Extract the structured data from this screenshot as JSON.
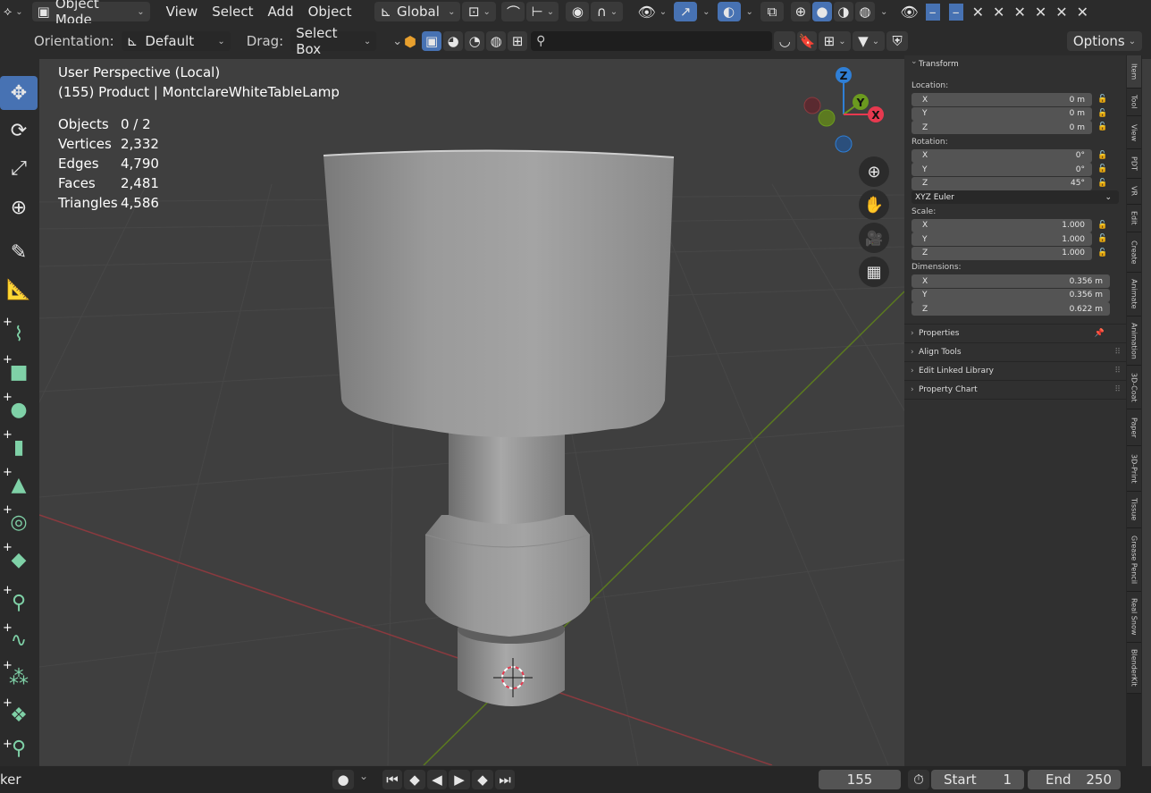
{
  "header": {
    "mode": "Object Mode",
    "menus": [
      "View",
      "Select",
      "Add",
      "Object"
    ],
    "transform_orientation": "Global",
    "options_label": "Options"
  },
  "tool_header": {
    "orientation_label": "Orientation:",
    "orientation_value": "Default",
    "drag_label": "Drag:",
    "drag_value": "Select Box",
    "search_placeholder": ""
  },
  "viewport": {
    "view_name": "User Perspective (Local)",
    "object_info": "(155) Product | MontclareWhiteTableLamp",
    "stats": [
      {
        "label": "Objects",
        "value": "0 / 2"
      },
      {
        "label": "Vertices",
        "value": "2,332"
      },
      {
        "label": "Edges",
        "value": "4,790"
      },
      {
        "label": "Faces",
        "value": "2,481"
      },
      {
        "label": "Triangles",
        "value": "4,586"
      }
    ],
    "gizmo": {
      "z": "Z",
      "y": "Y",
      "x": "X"
    }
  },
  "npanel": {
    "transform_title": "Transform",
    "location_label": "Location:",
    "location": [
      {
        "axis": "X",
        "value": "0 m"
      },
      {
        "axis": "Y",
        "value": "0 m"
      },
      {
        "axis": "Z",
        "value": "0 m"
      }
    ],
    "rotation_label": "Rotation:",
    "rotation": [
      {
        "axis": "X",
        "value": "0°"
      },
      {
        "axis": "Y",
        "value": "0°"
      },
      {
        "axis": "Z",
        "value": "45°"
      }
    ],
    "rotation_mode": "XYZ Euler",
    "scale_label": "Scale:",
    "scale": [
      {
        "axis": "X",
        "value": "1.000"
      },
      {
        "axis": "Y",
        "value": "1.000"
      },
      {
        "axis": "Z",
        "value": "1.000"
      }
    ],
    "dimensions_label": "Dimensions:",
    "dimensions": [
      {
        "axis": "X",
        "value": "0.356 m"
      },
      {
        "axis": "Y",
        "value": "0.356 m"
      },
      {
        "axis": "Z",
        "value": "0.622 m"
      }
    ],
    "sections": [
      "Properties",
      "Align Tools",
      "Edit Linked Library",
      "Property Chart"
    ]
  },
  "side_tabs": [
    "Item",
    "Tool",
    "View",
    "PDT",
    "VR",
    "Edit",
    "Create",
    "Animate",
    "Animation",
    "3D-Coat",
    "Paper",
    "3D-Print",
    "Tissue",
    "Grease Pencil",
    "Real Snow",
    "BlenderKit"
  ],
  "timeline": {
    "left_label": "ker",
    "current_frame": "155",
    "start_label": "Start",
    "start_value": "1",
    "end_label": "End",
    "end_value": "250"
  },
  "colors": {
    "accent": "#4772b3",
    "x_axis": "#e7394f",
    "y_axis": "#6b9a1f",
    "z_axis": "#2f7fd6"
  }
}
